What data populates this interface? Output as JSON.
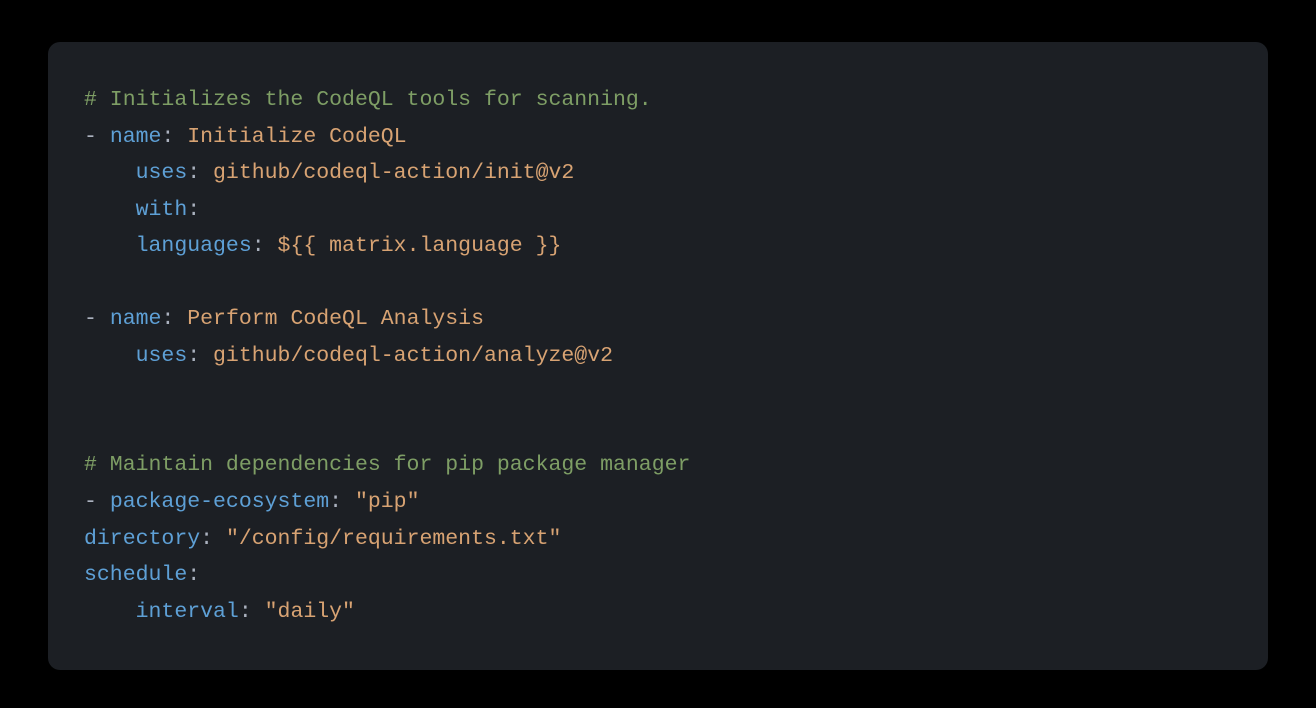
{
  "code": {
    "l1_comment": "# Initializes the CodeQL tools for scanning.",
    "l2_dash": "- ",
    "l2_key": "name",
    "l2_colon": ": ",
    "l2_val": "Initialize CodeQL",
    "l3_indent": "    ",
    "l3_key": "uses",
    "l3_colon": ": ",
    "l3_val": "github/codeql-action/init@v2",
    "l4_indent": "    ",
    "l4_key": "with",
    "l4_colon": ":",
    "l5_indent": "    ",
    "l5_key": "languages",
    "l5_colon": ": ",
    "l5_val": "${{ matrix.language }}",
    "l6_blank": "",
    "l7_dash": "- ",
    "l7_key": "name",
    "l7_colon": ": ",
    "l7_val": "Perform CodeQL Analysis",
    "l8_indent": "    ",
    "l8_key": "uses",
    "l8_colon": ": ",
    "l8_val": "github/codeql-action/analyze@v2",
    "l9_blank": "",
    "l10_blank": "",
    "l11_comment": "# Maintain dependencies for pip package manager",
    "l12_dash": "- ",
    "l12_key": "package-ecosystem",
    "l12_colon": ": ",
    "l12_val": "\"pip\"",
    "l13_key": "directory",
    "l13_colon": ": ",
    "l13_val": "\"/config/requirements.txt\"",
    "l14_key": "schedule",
    "l14_colon": ":",
    "l15_indent": "    ",
    "l15_key": "interval",
    "l15_colon": ": ",
    "l15_val": "\"daily\""
  }
}
